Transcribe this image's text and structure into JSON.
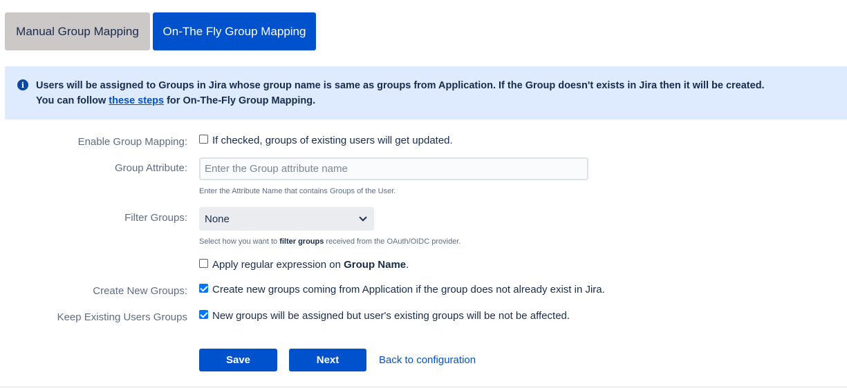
{
  "tabs": [
    {
      "label": "Manual Group Mapping",
      "active": false
    },
    {
      "label": "On-The Fly Group Mapping",
      "active": true
    }
  ],
  "info": {
    "icon": "info-icon",
    "line1": "Users will be assigned to Groups in Jira whose group name is same as groups from Application. If the Group doesn't exists in Jira then it will be created.",
    "line2_prefix": "You can follow ",
    "line2_link": "these steps",
    "line2_suffix": " for On-The-Fly Group Mapping."
  },
  "form": {
    "enable_group_mapping": {
      "label": "Enable Group Mapping:",
      "checkbox_text": "If checked, groups of existing users will get updated.",
      "checked": false
    },
    "group_attribute": {
      "label": "Group Attribute:",
      "value": "",
      "placeholder": "Enter the Group attribute name",
      "help": "Enter the Attribute Name that contains Groups of the User."
    },
    "filter_groups": {
      "label": "Filter Groups:",
      "selected": "None",
      "help_prefix": "Select how you want to ",
      "help_bold": "filter groups",
      "help_suffix": " received from the OAuth/OIDC provider."
    },
    "regex": {
      "text_prefix": "Apply regular expression on ",
      "text_bold": "Group Name",
      "text_suffix": ".",
      "checked": false
    },
    "create_new_groups": {
      "label": "Create New Groups:",
      "checkbox_text": "Create new groups coming from Application if the group does not already exist in Jira.",
      "checked": true
    },
    "keep_existing": {
      "label": "Keep Existing Users Groups",
      "checkbox_text": "New groups will be assigned but user's existing groups will be not be affected.",
      "checked": true
    }
  },
  "actions": {
    "save_label": "Save",
    "next_label": "Next",
    "back_label": "Back to configuration"
  },
  "colors": {
    "primary": "#0052cc",
    "info_bg": "#deebff",
    "inactive_tab": "#ccc8c8",
    "checkbox_checked": "#0075ff"
  }
}
